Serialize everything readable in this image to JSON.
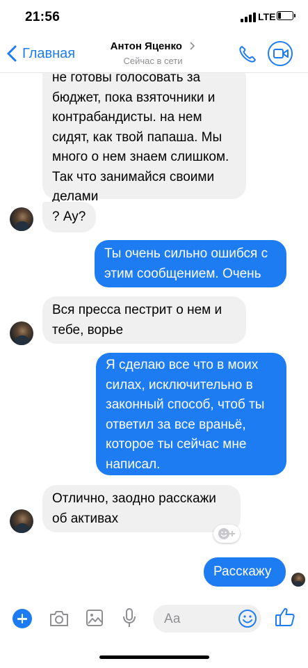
{
  "status_bar": {
    "time": "21:56",
    "network": "LTE"
  },
  "nav": {
    "back_label": "Главная",
    "contact_name": "Антон Яценко",
    "contact_status": "Сейчас в сети"
  },
  "messages": [
    {
      "direction": "incoming",
      "text": "не готовы голосовать за бюджет, пока взяточники и контрабандисты. на нем сидят, как твой папаша. Мы много о нем знаем слишком. Так что занимайся своими делами"
    },
    {
      "direction": "incoming",
      "text": "? Ау?"
    },
    {
      "direction": "outgoing",
      "text": "Ты очень сильно ошибся с этим сообщением. Очень"
    },
    {
      "direction": "incoming",
      "text": "Вся пресса пестрит о нем и тебе, ворье"
    },
    {
      "direction": "outgoing",
      "text": "Я сделаю все что в моих силах, исключительно в законный способ, чтоб ты ответил за все враньё, которое ты сейчас мне написал."
    },
    {
      "direction": "incoming",
      "text": "Отлично, заодно расскажи об активах"
    },
    {
      "direction": "outgoing",
      "text": "Расскажу"
    }
  ],
  "composer": {
    "placeholder": "Аа"
  },
  "colors": {
    "accent": "#1d7cf2",
    "incoming_bubble": "#f1f0f0",
    "outgoing_text": "#ffffff"
  },
  "icons": [
    "chevron-left-icon",
    "chevron-right-icon",
    "phone-icon",
    "video-camera-icon",
    "plus-icon",
    "camera-icon",
    "image-icon",
    "microphone-icon",
    "emoji-icon",
    "thumbs-up-icon",
    "add-reaction-icon"
  ]
}
